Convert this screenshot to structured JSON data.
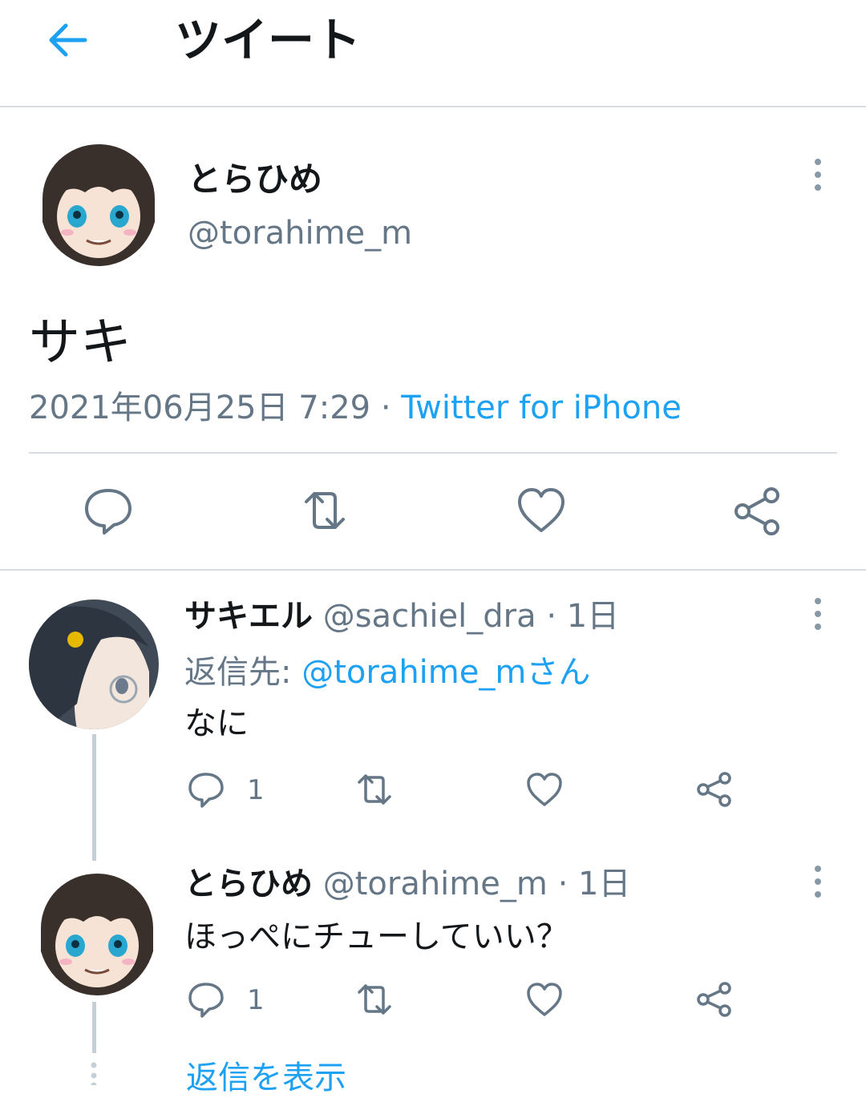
{
  "header": {
    "title": "ツイート",
    "back_icon": "arrow-left-icon"
  },
  "main_tweet": {
    "name": "とらひめ",
    "handle": "@torahime_m",
    "text": "サキ",
    "timestamp": "2021年06月25日 7:29",
    "separator": "·",
    "source": "Twitter for iPhone"
  },
  "replies": [
    {
      "name": "サキエル",
      "handle": "@sachiel_dra",
      "sep": "·",
      "age": "1日",
      "reply_to_label": "返信先: ",
      "reply_to_mention": "@torahime_mさん",
      "text": "なに",
      "reply_count": "1"
    },
    {
      "name": "とらひめ",
      "handle": "@torahime_m",
      "sep": "·",
      "age": "1日",
      "text": "ほっぺにチューしていい？",
      "reply_count": "1"
    }
  ],
  "show_replies": "返信を表示",
  "colors": {
    "accent": "#1da1f2",
    "muted": "#657786",
    "icon": "#657786",
    "divider": "#d9dde1"
  }
}
